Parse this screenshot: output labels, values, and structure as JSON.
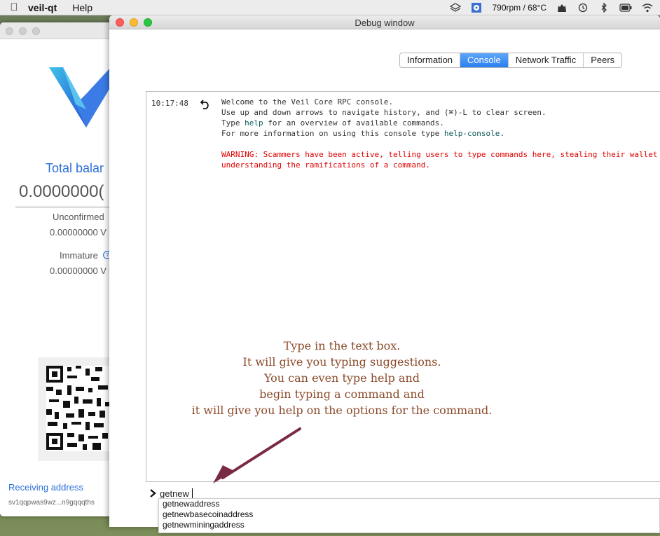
{
  "menubar": {
    "app_name": "veil-qt",
    "help_menu": "Help",
    "status_text": "790rpm / 68°C"
  },
  "wallet": {
    "total_label": "Total balar",
    "balance": "0.0000000(",
    "unconfirmed_label": "Unconfirmed",
    "unconfirmed_value": "0.00000000 V",
    "immature_label": "Immature",
    "immature_value": "0.00000000 V",
    "receiving_label": "Receiving address",
    "address": "sv1qqpwas9wz...n9gqqqths"
  },
  "debug": {
    "title": "Debug window",
    "tabs": [
      {
        "label": "Information"
      },
      {
        "label": "Console"
      },
      {
        "label": "Network Traffic"
      },
      {
        "label": "Peers"
      }
    ],
    "console": {
      "time": "10:17:48",
      "line1": "Welcome to the Veil Core RPC console.",
      "line2": "Use up and down arrows to navigate history, and (⌘)-L to clear screen.",
      "line3a": "Type ",
      "line3kw": "help",
      "line3b": " for an overview of available commands.",
      "line4a": "For more information on using this console type ",
      "line4kw": "help-console",
      "line4b": ".",
      "warn1": "WARNING: Scammers have been active, telling users to type commands here, stealing their wallet",
      "warn2": "understanding the ramifications of a command."
    },
    "annotation": [
      "Type in the text box.",
      "It will give you typing suggestions.",
      "You can even type help and",
      "begin typing a command and",
      "it will give you help on the options for the command."
    ],
    "input_value": "getnew",
    "suggestions": [
      "getnewaddress",
      "getnewbasecoinaddress",
      "getnewminingaddress"
    ]
  }
}
